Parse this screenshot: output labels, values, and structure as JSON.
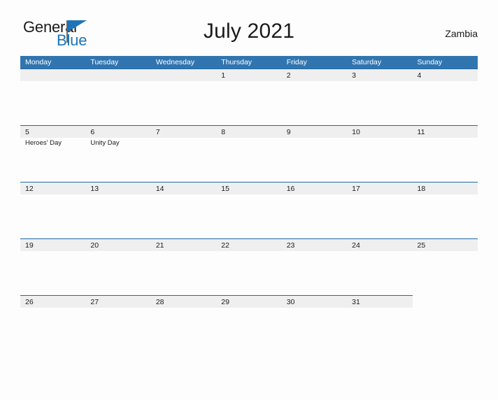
{
  "brand": {
    "name_part1": "General",
    "name_part2": "Blue",
    "flag_icon": "flag-icon"
  },
  "header": {
    "title": "July 2021",
    "region": "Zambia"
  },
  "colors": {
    "header_blue": "#3175b0",
    "row_line_blue": "#1f6aa8",
    "row_band_gray": "#efefef",
    "brand_blue": "#1f73b7",
    "page_background": "#fdfdfd",
    "text": "#1a1a1a"
  },
  "calendar": {
    "weekdays": [
      "Monday",
      "Tuesday",
      "Wednesday",
      "Thursday",
      "Friday",
      "Saturday",
      "Sunday"
    ],
    "weeks": [
      [
        {
          "day": "",
          "shaded": true,
          "events": []
        },
        {
          "day": "",
          "shaded": true,
          "events": []
        },
        {
          "day": "",
          "shaded": true,
          "events": []
        },
        {
          "day": "1",
          "shaded": true,
          "events": []
        },
        {
          "day": "2",
          "shaded": true,
          "events": []
        },
        {
          "day": "3",
          "shaded": true,
          "events": []
        },
        {
          "day": "4",
          "shaded": true,
          "events": []
        }
      ],
      [
        {
          "day": "5",
          "shaded": true,
          "events": [
            "Heroes' Day"
          ]
        },
        {
          "day": "6",
          "shaded": true,
          "events": [
            "Unity Day"
          ]
        },
        {
          "day": "7",
          "shaded": true,
          "events": []
        },
        {
          "day": "8",
          "shaded": true,
          "events": []
        },
        {
          "day": "9",
          "shaded": true,
          "events": []
        },
        {
          "day": "10",
          "shaded": true,
          "events": []
        },
        {
          "day": "11",
          "shaded": true,
          "events": []
        }
      ],
      [
        {
          "day": "12",
          "shaded": true,
          "events": []
        },
        {
          "day": "13",
          "shaded": true,
          "events": []
        },
        {
          "day": "14",
          "shaded": true,
          "events": []
        },
        {
          "day": "15",
          "shaded": true,
          "events": []
        },
        {
          "day": "16",
          "shaded": true,
          "events": []
        },
        {
          "day": "17",
          "shaded": true,
          "events": []
        },
        {
          "day": "18",
          "shaded": true,
          "events": []
        }
      ],
      [
        {
          "day": "19",
          "shaded": true,
          "events": []
        },
        {
          "day": "20",
          "shaded": true,
          "events": []
        },
        {
          "day": "21",
          "shaded": true,
          "events": []
        },
        {
          "day": "22",
          "shaded": true,
          "events": []
        },
        {
          "day": "23",
          "shaded": true,
          "events": []
        },
        {
          "day": "24",
          "shaded": true,
          "events": []
        },
        {
          "day": "25",
          "shaded": true,
          "events": []
        }
      ],
      [
        {
          "day": "26",
          "shaded": true,
          "events": []
        },
        {
          "day": "27",
          "shaded": true,
          "events": []
        },
        {
          "day": "28",
          "shaded": true,
          "events": []
        },
        {
          "day": "29",
          "shaded": true,
          "events": []
        },
        {
          "day": "30",
          "shaded": true,
          "events": []
        },
        {
          "day": "31",
          "shaded": true,
          "events": []
        },
        {
          "day": "",
          "shaded": false,
          "events": []
        }
      ]
    ]
  }
}
